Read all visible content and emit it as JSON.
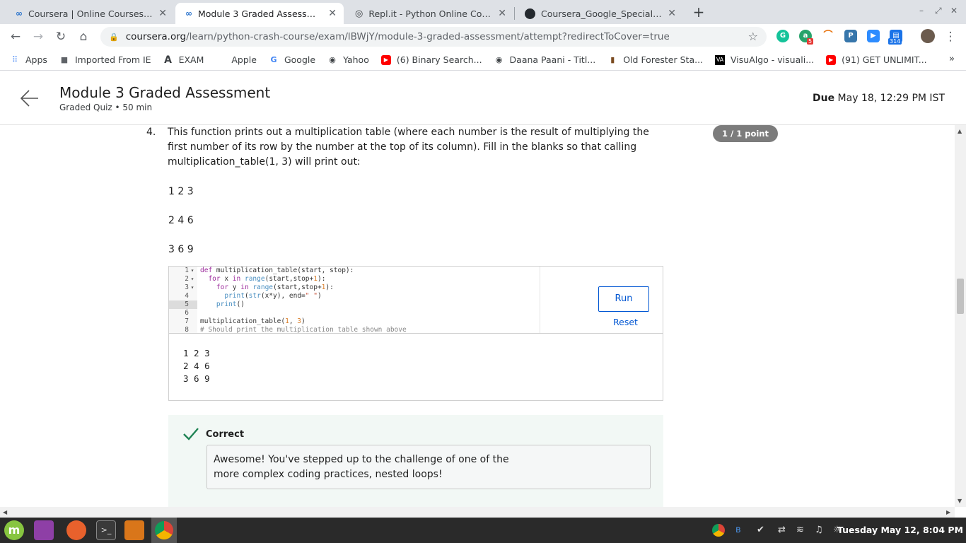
{
  "browser": {
    "tabs": [
      {
        "title": "Coursera | Online Courses & C",
        "icon": "coursera-icon",
        "active": false
      },
      {
        "title": "Module 3 Graded Assessment",
        "icon": "coursera-icon",
        "active": true
      },
      {
        "title": "Repl.it - Python Online Compil",
        "icon": "replit-icon",
        "active": false
      },
      {
        "title": "Coursera_Google_Speciallizat",
        "icon": "github-icon",
        "active": false
      }
    ],
    "url_host": "coursera.org",
    "url_path": "/learn/python-crash-course/exam/lBWjY/module-3-graded-assessment/attempt?redirectToCover=true",
    "extension_badges": {
      "a": "5",
      "calendar": "314"
    },
    "bookmarks": [
      {
        "label": "Apps",
        "icon": "apps-grid-icon"
      },
      {
        "label": "Imported From IE",
        "icon": "folder-icon"
      },
      {
        "label": "EXAM",
        "icon": "exam-a-icon"
      },
      {
        "label": "Apple",
        "icon": "apple-icon"
      },
      {
        "label": "Google",
        "icon": "google-icon"
      },
      {
        "label": "Yahoo",
        "icon": "globe-icon"
      },
      {
        "label": "(6) Binary Search...",
        "icon": "youtube-icon"
      },
      {
        "label": "Daana Paani - Titl...",
        "icon": "globe-icon"
      },
      {
        "label": "Old Forester Sta...",
        "icon": "bottle-icon"
      },
      {
        "label": "VisuAlgo - visuali...",
        "icon": "visualgo-icon"
      },
      {
        "label": "(91) GET UNLIMIT...",
        "icon": "youtube-icon"
      }
    ],
    "more_label": "»"
  },
  "header": {
    "title": "Module 3 Graded Assessment",
    "subtitle": "Graded Quiz • 50 min",
    "due_label": "Due",
    "due_value": "May 18, 12:29 PM IST"
  },
  "question": {
    "number": "4.",
    "text": "This function prints out a multiplication table (where each number is the result of multiplying the first number of its row by the number at the top of its column). Fill in the blanks so that calling multiplication_table(1, 3) will print out:",
    "points": "1 / 1 point",
    "expected_output": [
      "1 2 3",
      "2 4 6",
      "3 6 9"
    ]
  },
  "editor": {
    "lines": [
      {
        "n": "1",
        "fold": "▾",
        "code": "def multiplication_table(start, stop):"
      },
      {
        "n": "2",
        "fold": "▾",
        "code": "  for x in range(start,stop+1):"
      },
      {
        "n": "3",
        "fold": "▾",
        "code": "    for y in range(start,stop+1):"
      },
      {
        "n": "4",
        "fold": "",
        "code": "      print(str(x*y), end=\" \")"
      },
      {
        "n": "5",
        "fold": "",
        "code": "    print()"
      },
      {
        "n": "6",
        "fold": "",
        "code": ""
      },
      {
        "n": "7",
        "fold": "",
        "code": "multiplication_table(1, 3)"
      },
      {
        "n": "8",
        "fold": "",
        "code": "# Should print the multiplication table shown above"
      }
    ],
    "highlighted_line": "5",
    "run_label": "Run",
    "reset_label": "Reset"
  },
  "output": {
    "lines": [
      "1 2 3",
      "2 4 6",
      "3 6 9"
    ]
  },
  "feedback": {
    "status": "Correct",
    "message_line1": "Awesome! You've stepped up to the challenge of one of the",
    "message_line2": "more complex coding practices, nested loops!"
  },
  "taskbar": {
    "datetime": "Tuesday May 12,  8:04 PM"
  },
  "colors": {
    "accent": "#0056d2",
    "correct_green": "#1f8354",
    "feedback_bg": "#f2f8f5",
    "points_badge": "#7c7c7c"
  }
}
